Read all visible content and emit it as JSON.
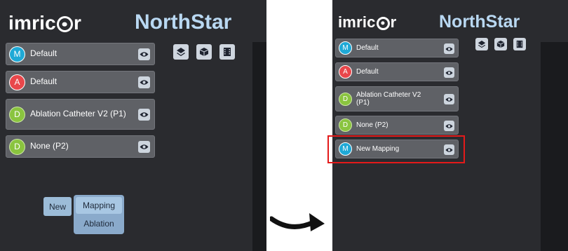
{
  "brand": {
    "logo_left": "imric",
    "logo_right": "r",
    "product": "NorthStar"
  },
  "icons": {
    "layers": "layers-icon",
    "cube": "cube-icon",
    "film": "film-icon",
    "eye": "eye-icon"
  },
  "colors": {
    "mapping": "#1fa9d6",
    "ablation": "#e8474b",
    "device": "#8ac43f",
    "highlight": "#e41a1a"
  },
  "before": {
    "items": [
      {
        "badge": "M",
        "label": "Default"
      },
      {
        "badge": "A",
        "label": "Default"
      },
      {
        "badge": "D",
        "label": "Ablation Catheter V2 (P1)"
      },
      {
        "badge": "D",
        "label": "None (P2)"
      }
    ],
    "menu": {
      "new_label": "New",
      "options": [
        "Mapping",
        "Ablation"
      ]
    }
  },
  "after": {
    "items": [
      {
        "badge": "M",
        "label": "Default"
      },
      {
        "badge": "A",
        "label": "Default"
      },
      {
        "badge": "D",
        "label": "Ablation Catheter V2 (P1)"
      },
      {
        "badge": "D",
        "label": "None (P2)"
      },
      {
        "badge": "M",
        "label": "New Mapping"
      }
    ]
  }
}
